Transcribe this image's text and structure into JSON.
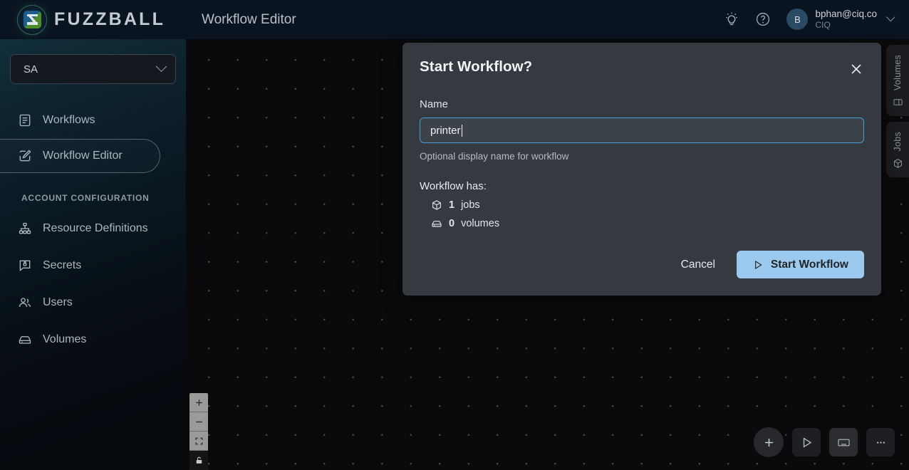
{
  "brand": {
    "name": "FUZZBALL",
    "logo_icon": "fuzzball-logo-icon"
  },
  "sidebar": {
    "account_select": {
      "value": "SA",
      "chevron_icon": "chevron-down-icon"
    },
    "items": [
      {
        "label": "Workflows",
        "icon": "list-document-icon",
        "active": false
      },
      {
        "label": "Workflow Editor",
        "icon": "pencil-square-icon",
        "active": true
      }
    ],
    "section_title": "ACCOUNT CONFIGURATION",
    "config_items": [
      {
        "label": "Resource Definitions",
        "icon": "hierarchy-icon"
      },
      {
        "label": "Secrets",
        "icon": "secret-lock-icon"
      },
      {
        "label": "Users",
        "icon": "users-icon"
      },
      {
        "label": "Volumes",
        "icon": "drive-icon"
      }
    ]
  },
  "header": {
    "title": "Workflow Editor",
    "theme_icon": "lightbulb-icon",
    "help_icon": "question-circle-icon",
    "user": {
      "avatar_initial": "B",
      "email": "bphan@ciq.co",
      "org": "CIQ",
      "chevron_icon": "chevron-down-icon"
    }
  },
  "canvas": {
    "side_tabs": [
      {
        "label": "Volumes",
        "icon": "volume-icon"
      },
      {
        "label": "Jobs",
        "icon": "job-cube-icon"
      }
    ],
    "zoom_controls": [
      {
        "name": "zoom-in",
        "icon": "plus-icon"
      },
      {
        "name": "zoom-out",
        "icon": "minus-icon"
      },
      {
        "name": "fit-view",
        "icon": "fit-view-icon"
      },
      {
        "name": "lock-canvas",
        "icon": "lock-icon"
      }
    ],
    "toolbar": [
      {
        "name": "add-node-button",
        "icon": "plus-icon"
      },
      {
        "name": "run-button",
        "icon": "play-icon"
      },
      {
        "name": "keyboard-shortcuts-button",
        "icon": "keyboard-icon"
      },
      {
        "name": "more-options-button",
        "icon": "ellipsis-icon"
      }
    ]
  },
  "modal": {
    "title": "Start Workflow?",
    "close_icon": "close-icon",
    "name_label": "Name",
    "name_value": "printer",
    "name_placeholder": "",
    "name_help": "Optional display name for workflow",
    "summary_label": "Workflow has:",
    "stats": [
      {
        "count": "1",
        "label": "jobs",
        "icon": "job-cube-icon"
      },
      {
        "count": "0",
        "label": "volumes",
        "icon": "drive-icon"
      }
    ],
    "cancel_label": "Cancel",
    "start_label": "Start Workflow",
    "start_icon": "play-icon",
    "accent_color": "#9ccaee",
    "focus_border_color": "#4a9eda"
  }
}
